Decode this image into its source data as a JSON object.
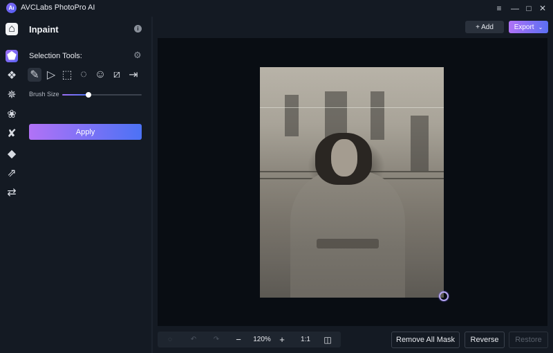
{
  "app": {
    "title": "AVCLabs PhotoPro AI",
    "logo_glyph": "Aı"
  },
  "window_controls": [
    {
      "name": "menu-icon",
      "glyph": "≡"
    },
    {
      "name": "minimize-icon",
      "glyph": "—"
    },
    {
      "name": "maximize-icon",
      "glyph": "□"
    },
    {
      "name": "close-icon",
      "glyph": "✕"
    }
  ],
  "rail": [
    {
      "name": "home-icon",
      "glyph": "⌂"
    },
    {
      "name": "inpaint-eraser-icon",
      "glyph": "⬟",
      "active": true
    },
    {
      "name": "background-remover-icon",
      "glyph": "❖"
    },
    {
      "name": "enhancer-icon",
      "glyph": "✵"
    },
    {
      "name": "face-retouch-icon",
      "glyph": "❀"
    },
    {
      "name": "colorize-fan-icon",
      "glyph": "✘"
    },
    {
      "name": "color-fill-icon",
      "glyph": "◆"
    },
    {
      "name": "upscale-icon",
      "glyph": "⇗"
    },
    {
      "name": "adjust-icon",
      "glyph": "⇄"
    }
  ],
  "panel": {
    "title": "Inpaint",
    "info_glyph": "i",
    "selection_label": "Selection Tools:",
    "settings_glyph": "⚙",
    "tools": [
      {
        "name": "brush-tool",
        "glyph": "✎",
        "active": true
      },
      {
        "name": "polygon-lasso-tool",
        "glyph": "▷"
      },
      {
        "name": "rectangle-select-tool",
        "glyph": "⬚"
      },
      {
        "name": "ellipse-select-tool",
        "glyph": "◌"
      },
      {
        "name": "portrait-select-tool",
        "glyph": "☺"
      },
      {
        "name": "auto-select-tool",
        "glyph": "⧄"
      },
      {
        "name": "import-mask-tool",
        "glyph": "⇥"
      }
    ],
    "brush_size_label": "Brush Size",
    "brush_size_fraction": 0.33,
    "apply_label": "Apply"
  },
  "header": {
    "add_label": "+ Add",
    "export_label": "Export",
    "export_chevron": "⌵"
  },
  "zoombar": {
    "reset_glyph": "◌",
    "undo_glyph": "↶",
    "redo_glyph": "↷",
    "zoom_out_glyph": "−",
    "zoom_level": "120%",
    "zoom_in_glyph": "+",
    "actual_size_label": "1:1",
    "compare_glyph": "◫"
  },
  "actions": {
    "remove_all_mask": "Remove All Mask",
    "reverse": "Reverse",
    "restore": "Restore"
  },
  "colors": {
    "accent_start": "#b172f6",
    "accent_end": "#4c72f5",
    "background": "#141a23",
    "canvas": "#090d13"
  }
}
